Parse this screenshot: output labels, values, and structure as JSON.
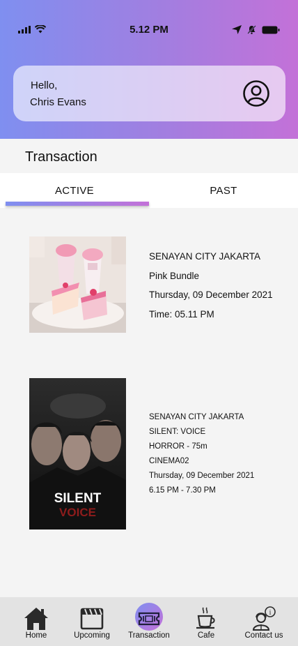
{
  "status_bar": {
    "time": "5.12 PM"
  },
  "greeting": {
    "hello": "Hello,",
    "name": "Chris Evans"
  },
  "page_title": "Transaction",
  "tabs": [
    {
      "label": "ACTIVE",
      "active": true
    },
    {
      "label": "PAST",
      "active": false
    }
  ],
  "transactions": [
    {
      "lines": [
        "SENAYAN CITY JAKARTA",
        "Pink Bundle",
        "Thursday, 09 December 2021",
        "Time: 05.11 PM"
      ]
    },
    {
      "poster_title": "SILENT",
      "poster_subtitle": "VOICE",
      "lines": [
        "SENAYAN CITY JAKARTA",
        "SILENT: VOICE",
        "HORROR - 75m",
        "CINEMA02",
        "Thursday, 09 December 2021",
        "6.15 PM - 7.30 PM"
      ]
    }
  ],
  "bottom_nav": [
    {
      "label": "Home",
      "icon": "home-icon"
    },
    {
      "label": "Upcoming",
      "icon": "clapperboard-icon"
    },
    {
      "label": "Transaction",
      "icon": "ticket-icon",
      "active": true
    },
    {
      "label": "Cafe",
      "icon": "coffee-cup-icon"
    },
    {
      "label": "Contact us",
      "icon": "support-agent-icon"
    }
  ],
  "colors": {
    "gradient_start": "#7f8ff0",
    "gradient_end": "#c371d8"
  }
}
